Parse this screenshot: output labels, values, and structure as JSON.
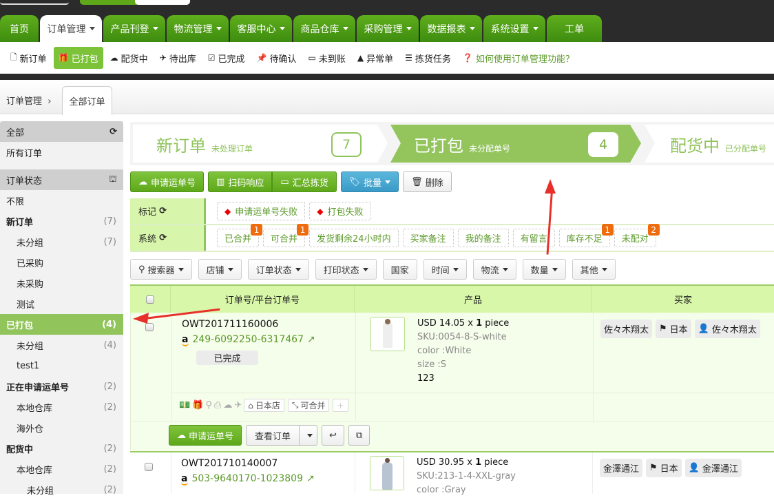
{
  "nav": {
    "tabs": [
      {
        "label": "首页",
        "caret": false
      },
      {
        "label": "订单管理",
        "caret": true,
        "active": true
      },
      {
        "label": "产品刊登",
        "caret": true
      },
      {
        "label": "物流管理",
        "caret": true
      },
      {
        "label": "客服中心",
        "caret": true
      },
      {
        "label": "商品仓库",
        "caret": true
      },
      {
        "label": "采购管理",
        "caret": true
      },
      {
        "label": "数据报表",
        "caret": true
      },
      {
        "label": "系统设置",
        "caret": true
      },
      {
        "label": "工单",
        "caret": false
      }
    ]
  },
  "subnav": {
    "items": [
      {
        "label": "新订单",
        "icon": "file-icon"
      },
      {
        "label": "已打包",
        "icon": "gift-icon",
        "active": true
      },
      {
        "label": "配货中",
        "icon": "cloud-upload-icon"
      },
      {
        "label": "待出库",
        "icon": "plane-icon"
      },
      {
        "label": "已完成",
        "icon": "check-square-icon"
      },
      {
        "label": "待确认",
        "icon": "pin-icon"
      },
      {
        "label": "未到账",
        "icon": "credit-card-icon"
      },
      {
        "label": "异常单",
        "icon": "warning-icon"
      },
      {
        "label": "拣货任务",
        "icon": "tasks-icon"
      }
    ],
    "help": "如何使用订单管理功能？"
  },
  "breadcrumb": {
    "parent": "订单管理",
    "separator": "›",
    "current_tab": "全部订单"
  },
  "sidebar": {
    "all_header": "全部",
    "all_orders": "所有订单",
    "status_header": "订单状态",
    "items": [
      {
        "label": "不限",
        "level": 0,
        "bold": false,
        "count": ""
      },
      {
        "label": "新订单",
        "level": 0,
        "bold": true,
        "count": "(7)"
      },
      {
        "label": "未分组",
        "level": 1,
        "bold": false,
        "count": "(7)"
      },
      {
        "label": "已采购",
        "level": 1,
        "bold": false,
        "count": ""
      },
      {
        "label": "未采购",
        "level": 1,
        "bold": false,
        "count": ""
      },
      {
        "label": "测试",
        "level": 1,
        "bold": false,
        "count": ""
      },
      {
        "label": "已打包",
        "level": 0,
        "bold": true,
        "count": "(4)",
        "active": true
      },
      {
        "label": "未分组",
        "level": 1,
        "bold": false,
        "count": "(4)"
      },
      {
        "label": "test1",
        "level": 1,
        "bold": false,
        "count": ""
      },
      {
        "label": "正在申请运单号",
        "level": 0,
        "bold": true,
        "count": "(2)"
      },
      {
        "label": "本地仓库",
        "level": 1,
        "bold": false,
        "count": "(2)"
      },
      {
        "label": "海外仓",
        "level": 1,
        "bold": false,
        "count": ""
      },
      {
        "label": "配货中",
        "level": 0,
        "bold": true,
        "count": "(2)"
      },
      {
        "label": "本地仓库",
        "level": 1,
        "bold": false,
        "count": "(2)"
      },
      {
        "label": "未分组",
        "level": 2,
        "bold": false,
        "count": "(2)"
      }
    ]
  },
  "steps": [
    {
      "title": "新订单",
      "sub": "未处理订单",
      "count": "7"
    },
    {
      "title": "已打包",
      "sub": "未分配单号",
      "count": "4",
      "active": true
    },
    {
      "title": "配货中",
      "sub": "已分配单号",
      "count": ""
    }
  ],
  "actions": {
    "apply_waybill": "申请运单号",
    "scan_response": "扫码响应",
    "summary_pick": "汇总拣货",
    "batch": "批量",
    "delete": "删除"
  },
  "tags": {
    "mark_label": "标记",
    "mark_items": [
      {
        "label": "申请运单号失败"
      },
      {
        "label": "打包失败"
      }
    ],
    "system_label": "系统",
    "system_items": [
      {
        "label": "已合并",
        "badge": "1"
      },
      {
        "label": "可合并",
        "badge": "1"
      },
      {
        "label": "发货剩余24小时内",
        "badge": ""
      },
      {
        "label": "买家备注",
        "badge": ""
      },
      {
        "label": "我的备注",
        "badge": ""
      },
      {
        "label": "有留言",
        "badge": ""
      },
      {
        "label": "库存不足",
        "badge": "1"
      },
      {
        "label": "未配对",
        "badge": "2"
      }
    ]
  },
  "filters": [
    {
      "label": "搜索器",
      "icon": "search-icon",
      "caret": true
    },
    {
      "label": "店铺",
      "caret": true
    },
    {
      "label": "订单状态",
      "caret": true
    },
    {
      "label": "打印状态",
      "caret": true
    },
    {
      "label": "国家",
      "caret": false
    },
    {
      "label": "时间",
      "caret": true
    },
    {
      "label": "物流",
      "caret": true
    },
    {
      "label": "数量",
      "caret": true
    },
    {
      "label": "其他",
      "caret": true
    }
  ],
  "table": {
    "columns": [
      "订单号/平台订单号",
      "产品",
      "买家"
    ],
    "rows": [
      {
        "order_no": "OWT201711160006",
        "platform_no": "249-6092250-6317467",
        "status": "已完成",
        "price": "USD 14.05 x ",
        "qty": "1",
        "unit": " piece",
        "sku": "SKU:0054-8-S-white",
        "color": "color :White",
        "size": "size :S",
        "note": "123",
        "buyer_name": "佐々木翔太",
        "country": "日本",
        "buyer_user": "佐々木翔太",
        "shop": "日本店",
        "mergeable": "可合并",
        "apply_btn": "申请运单号",
        "view_btn": "查看订单"
      },
      {
        "order_no": "OWT201710140007",
        "platform_no": "503-9640170-1023809",
        "price": "USD 30.95 x ",
        "qty": "1",
        "unit": " piece",
        "sku": "SKU:213-1-4-XXL-gray",
        "color": "color :Gray",
        "buyer_name": "金澤通江",
        "country": "日本",
        "buyer_user": "金澤通江"
      }
    ]
  }
}
